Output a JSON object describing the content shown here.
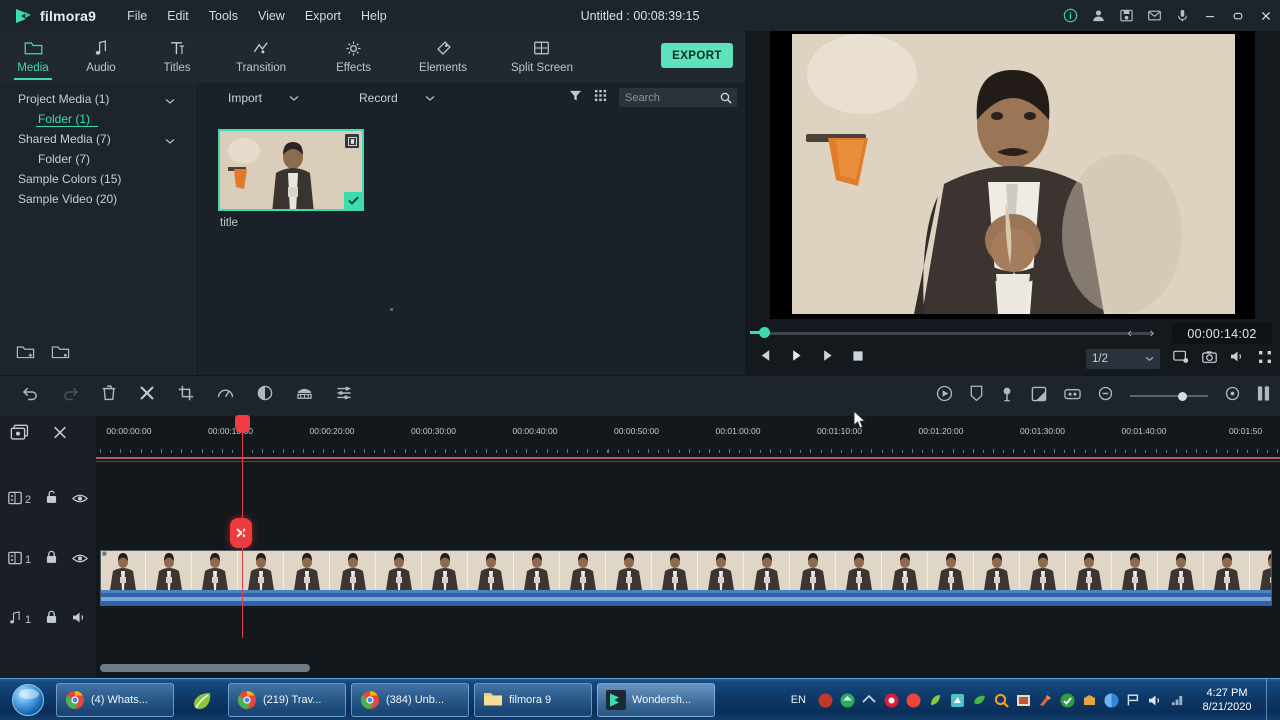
{
  "app": {
    "brand": "filmora9",
    "project_title": "Untitled : 00:08:39:15"
  },
  "menubar": {
    "items": [
      "File",
      "Edit",
      "Tools",
      "View",
      "Export",
      "Help"
    ],
    "window_icons": [
      "info-icon",
      "account-icon",
      "save-icon",
      "feedback-icon",
      "mic-icon"
    ],
    "controls": {
      "minimize": "–",
      "maximize": "▭",
      "close": "✕"
    }
  },
  "tabs": [
    {
      "label": "Media",
      "icon": "folder-icon",
      "active": true
    },
    {
      "label": "Audio",
      "icon": "music-note-icon",
      "active": false
    },
    {
      "label": "Titles",
      "icon": "text-icon",
      "active": false
    },
    {
      "label": "Transition",
      "icon": "transition-icon",
      "active": false
    },
    {
      "label": "Effects",
      "icon": "effects-icon",
      "active": false
    },
    {
      "label": "Elements",
      "icon": "elements-icon",
      "active": false
    },
    {
      "label": "Split Screen",
      "icon": "split-screen-icon",
      "active": false
    }
  ],
  "export_button": "EXPORT",
  "sidebar": {
    "items": [
      {
        "label": "Project Media (1)",
        "level": 0,
        "chevron": true,
        "selected": false
      },
      {
        "label": "Folder (1)",
        "level": 1,
        "chevron": false,
        "selected": true
      },
      {
        "label": "Shared Media (7)",
        "level": 0,
        "chevron": true,
        "selected": false
      },
      {
        "label": "Folder (7)",
        "level": 1,
        "chevron": false,
        "selected": false
      },
      {
        "label": "Sample Colors (15)",
        "level": 0,
        "chevron": false,
        "selected": false
      },
      {
        "label": "Sample Video (20)",
        "level": 0,
        "chevron": false,
        "selected": false
      }
    ],
    "bottom_icons": [
      "new-folder-icon",
      "folder-settings-icon"
    ]
  },
  "media_toolbar": {
    "import_label": "Import",
    "record_label": "Record",
    "filter_icon": "filter-icon",
    "grid_icon": "grid-view-icon",
    "search_placeholder": "Search",
    "search_value": ""
  },
  "media_items": [
    {
      "name": "title",
      "badge": "timeline-badge",
      "selected": true,
      "check": "✔"
    }
  ],
  "preview": {
    "timecode": "00:00:14:02",
    "in_brace": "‹",
    "out_brace": "›",
    "ratio": "1/2",
    "controls": [
      "prev-frame-button",
      "play-button",
      "next-frame-button",
      "stop-button"
    ],
    "right_icons": [
      "snapshot-to-media-icon",
      "camera-icon",
      "volume-icon",
      "fullscreen-icon"
    ]
  },
  "timeline_toolbar": {
    "left_icons": [
      "undo-icon",
      "redo-icon",
      "delete-icon",
      "split-icon",
      "crop-icon",
      "speed-icon",
      "color-icon",
      "green-screen-icon",
      "audio-mixer-icon"
    ],
    "right_icons": [
      "render-preview-icon",
      "marker-icon",
      "voiceover-icon",
      "freeze-frame-icon",
      "keyframe-icon",
      "zoom-out-icon"
    ],
    "zoom_in_icon": "zoom-in-icon",
    "end_icon": "fit-timeline-icon"
  },
  "timeline": {
    "head_icons": [
      "add-track-icon",
      "unlink-audio-icon"
    ],
    "tracks": [
      {
        "id": "video-2",
        "type": "video",
        "number": "2",
        "lock": "unlocked-icon",
        "visibility": "eye-icon"
      },
      {
        "id": "video-1",
        "type": "video",
        "number": "1",
        "lock": "locked-icon",
        "visibility": "eye-icon"
      },
      {
        "id": "audio-1",
        "type": "audio",
        "number": "1",
        "lock": "locked-icon",
        "visibility": "speaker-icon"
      }
    ],
    "ruler_labels": [
      "00:00:00:00",
      "00:00:10:00",
      "00:00:20:00",
      "00:00:30:00",
      "00:00:40:00",
      "00:00:50:00",
      "00:01:00:00",
      "00:01:10:00",
      "00:01:20:00",
      "00:01:30:00",
      "00:01:40:00",
      "00:01:50"
    ],
    "playhead_position": "00:00:10:00",
    "marker_label": "✕"
  },
  "taskbar": {
    "start": "start-orb",
    "tasks": [
      {
        "label": "(4) Whats...",
        "icon": "chrome-icon",
        "active": false,
        "narrow": false
      },
      {
        "label": "",
        "icon": "leaf-icon",
        "active": false,
        "narrow": true
      },
      {
        "label": "(219) Trav...",
        "icon": "chrome-icon",
        "active": false,
        "narrow": false
      },
      {
        "label": "(384) Unb...",
        "icon": "chrome-icon",
        "active": false,
        "narrow": false
      },
      {
        "label": "filmora 9",
        "icon": "folder-icon",
        "active": false,
        "narrow": false
      },
      {
        "label": "Wondersh...",
        "icon": "filmora-icon",
        "active": true,
        "narrow": false
      }
    ],
    "language": "EN",
    "clock_time": "4:27 PM",
    "clock_date": "8/21/2020"
  },
  "colors": {
    "accent": "#3ddbb0",
    "export": "#5fe3bd",
    "playhead": "#e0404a",
    "panel_bg": "#1e242b",
    "timeline_bg": "#13181d",
    "clip_audio": "#2e63a8"
  }
}
